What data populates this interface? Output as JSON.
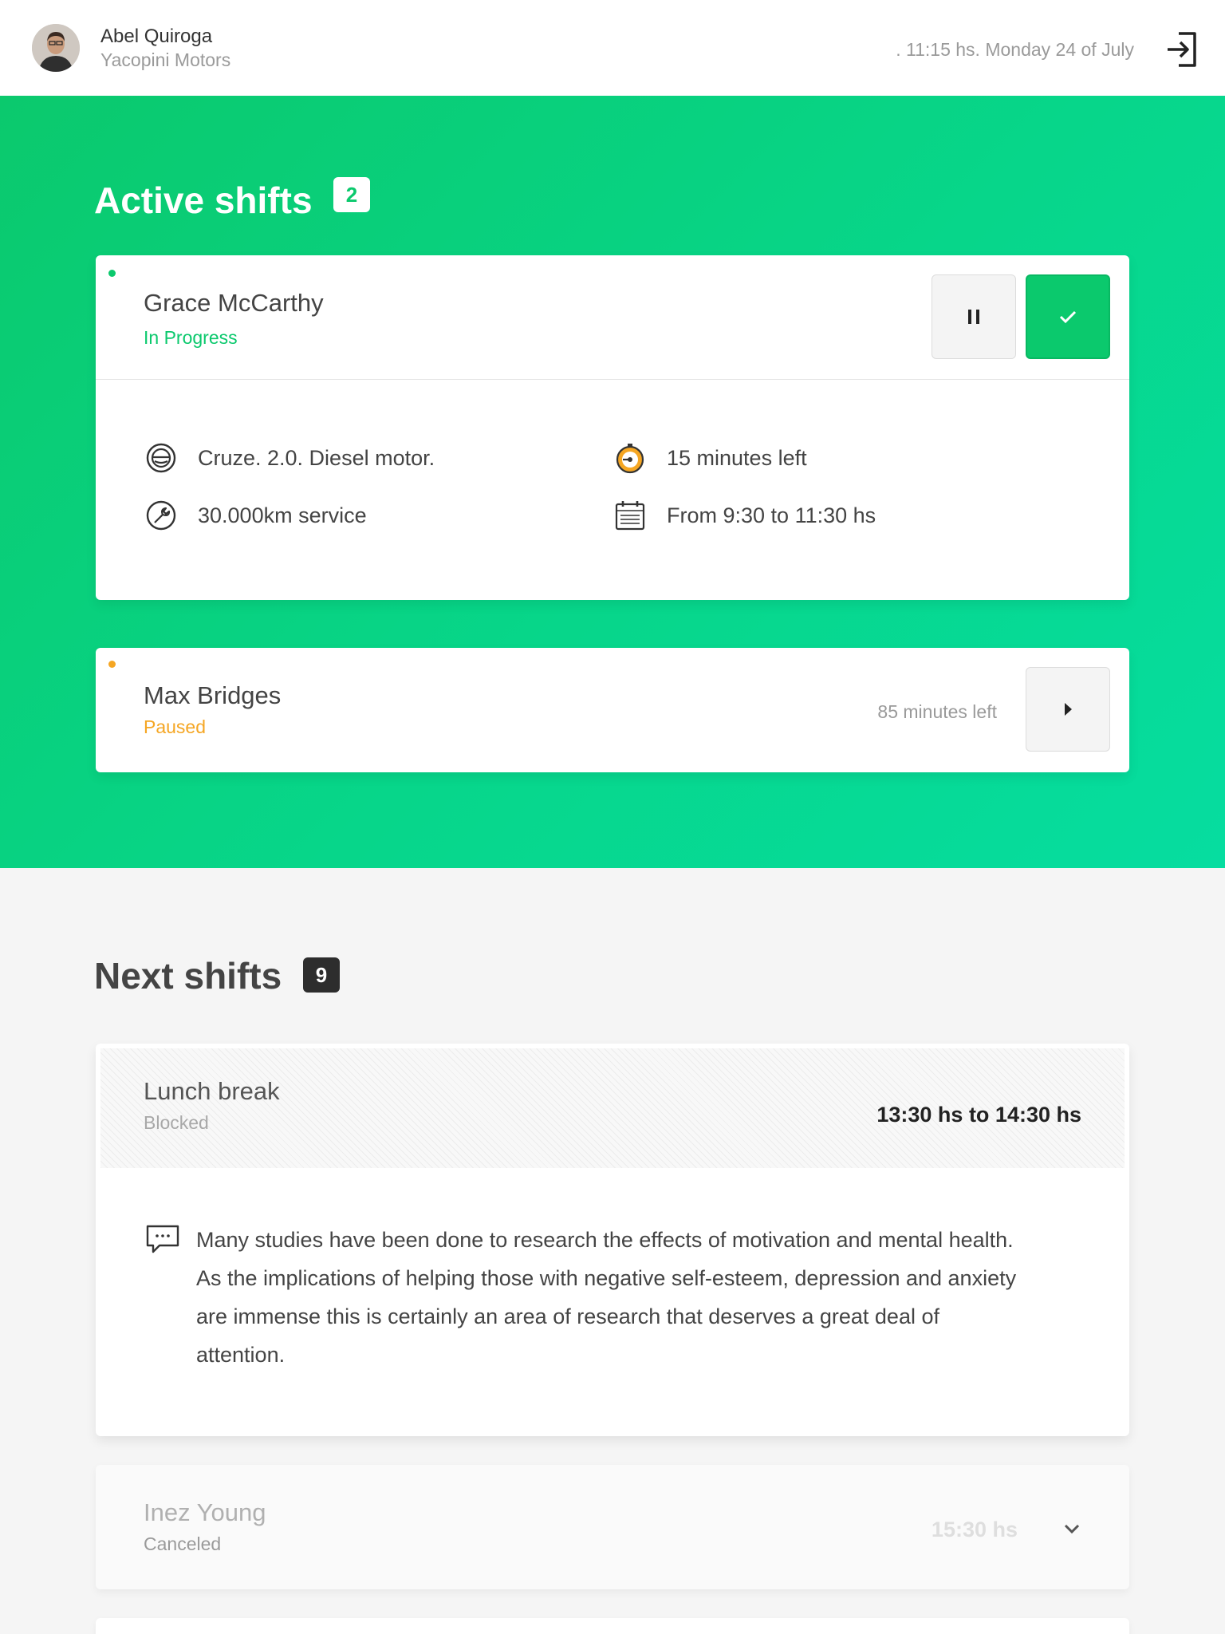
{
  "header": {
    "user_name": "Abel Quiroga",
    "company": "Yacopini Motors",
    "datetime": ". 11:15 hs. Monday 24 of July"
  },
  "active": {
    "title": "Active shifts",
    "count": "2",
    "shifts": [
      {
        "name": "Grace McCarthy",
        "status": "In Progress",
        "status_color": "#0bc96d",
        "details": {
          "vehicle": "Cruze. 2.0. Diesel motor.",
          "service": "30.000km service",
          "time_left": "15 minutes left",
          "schedule": "From 9:30 to 11:30 hs"
        }
      },
      {
        "name": "Max Bridges",
        "status": "Paused",
        "status_color": "#f5a623",
        "time_left": "85 minutes left"
      }
    ]
  },
  "next": {
    "title": "Next shifts",
    "count": "9",
    "shifts": [
      {
        "name": "Lunch break",
        "status": "Blocked",
        "time": "13:30 hs to 14:30 hs",
        "note": "Many studies have been done to research the effects of motivation and mental health. As the implications of helping those with negative self-esteem, depression and anxiety are immense this is certainly an area of research that deserves a great deal of attention."
      },
      {
        "name": "Inez Young",
        "status": "Canceled",
        "time": "15:30 hs"
      }
    ]
  },
  "colors": {
    "accent": "#0bc96d",
    "paused": "#f5a623"
  }
}
